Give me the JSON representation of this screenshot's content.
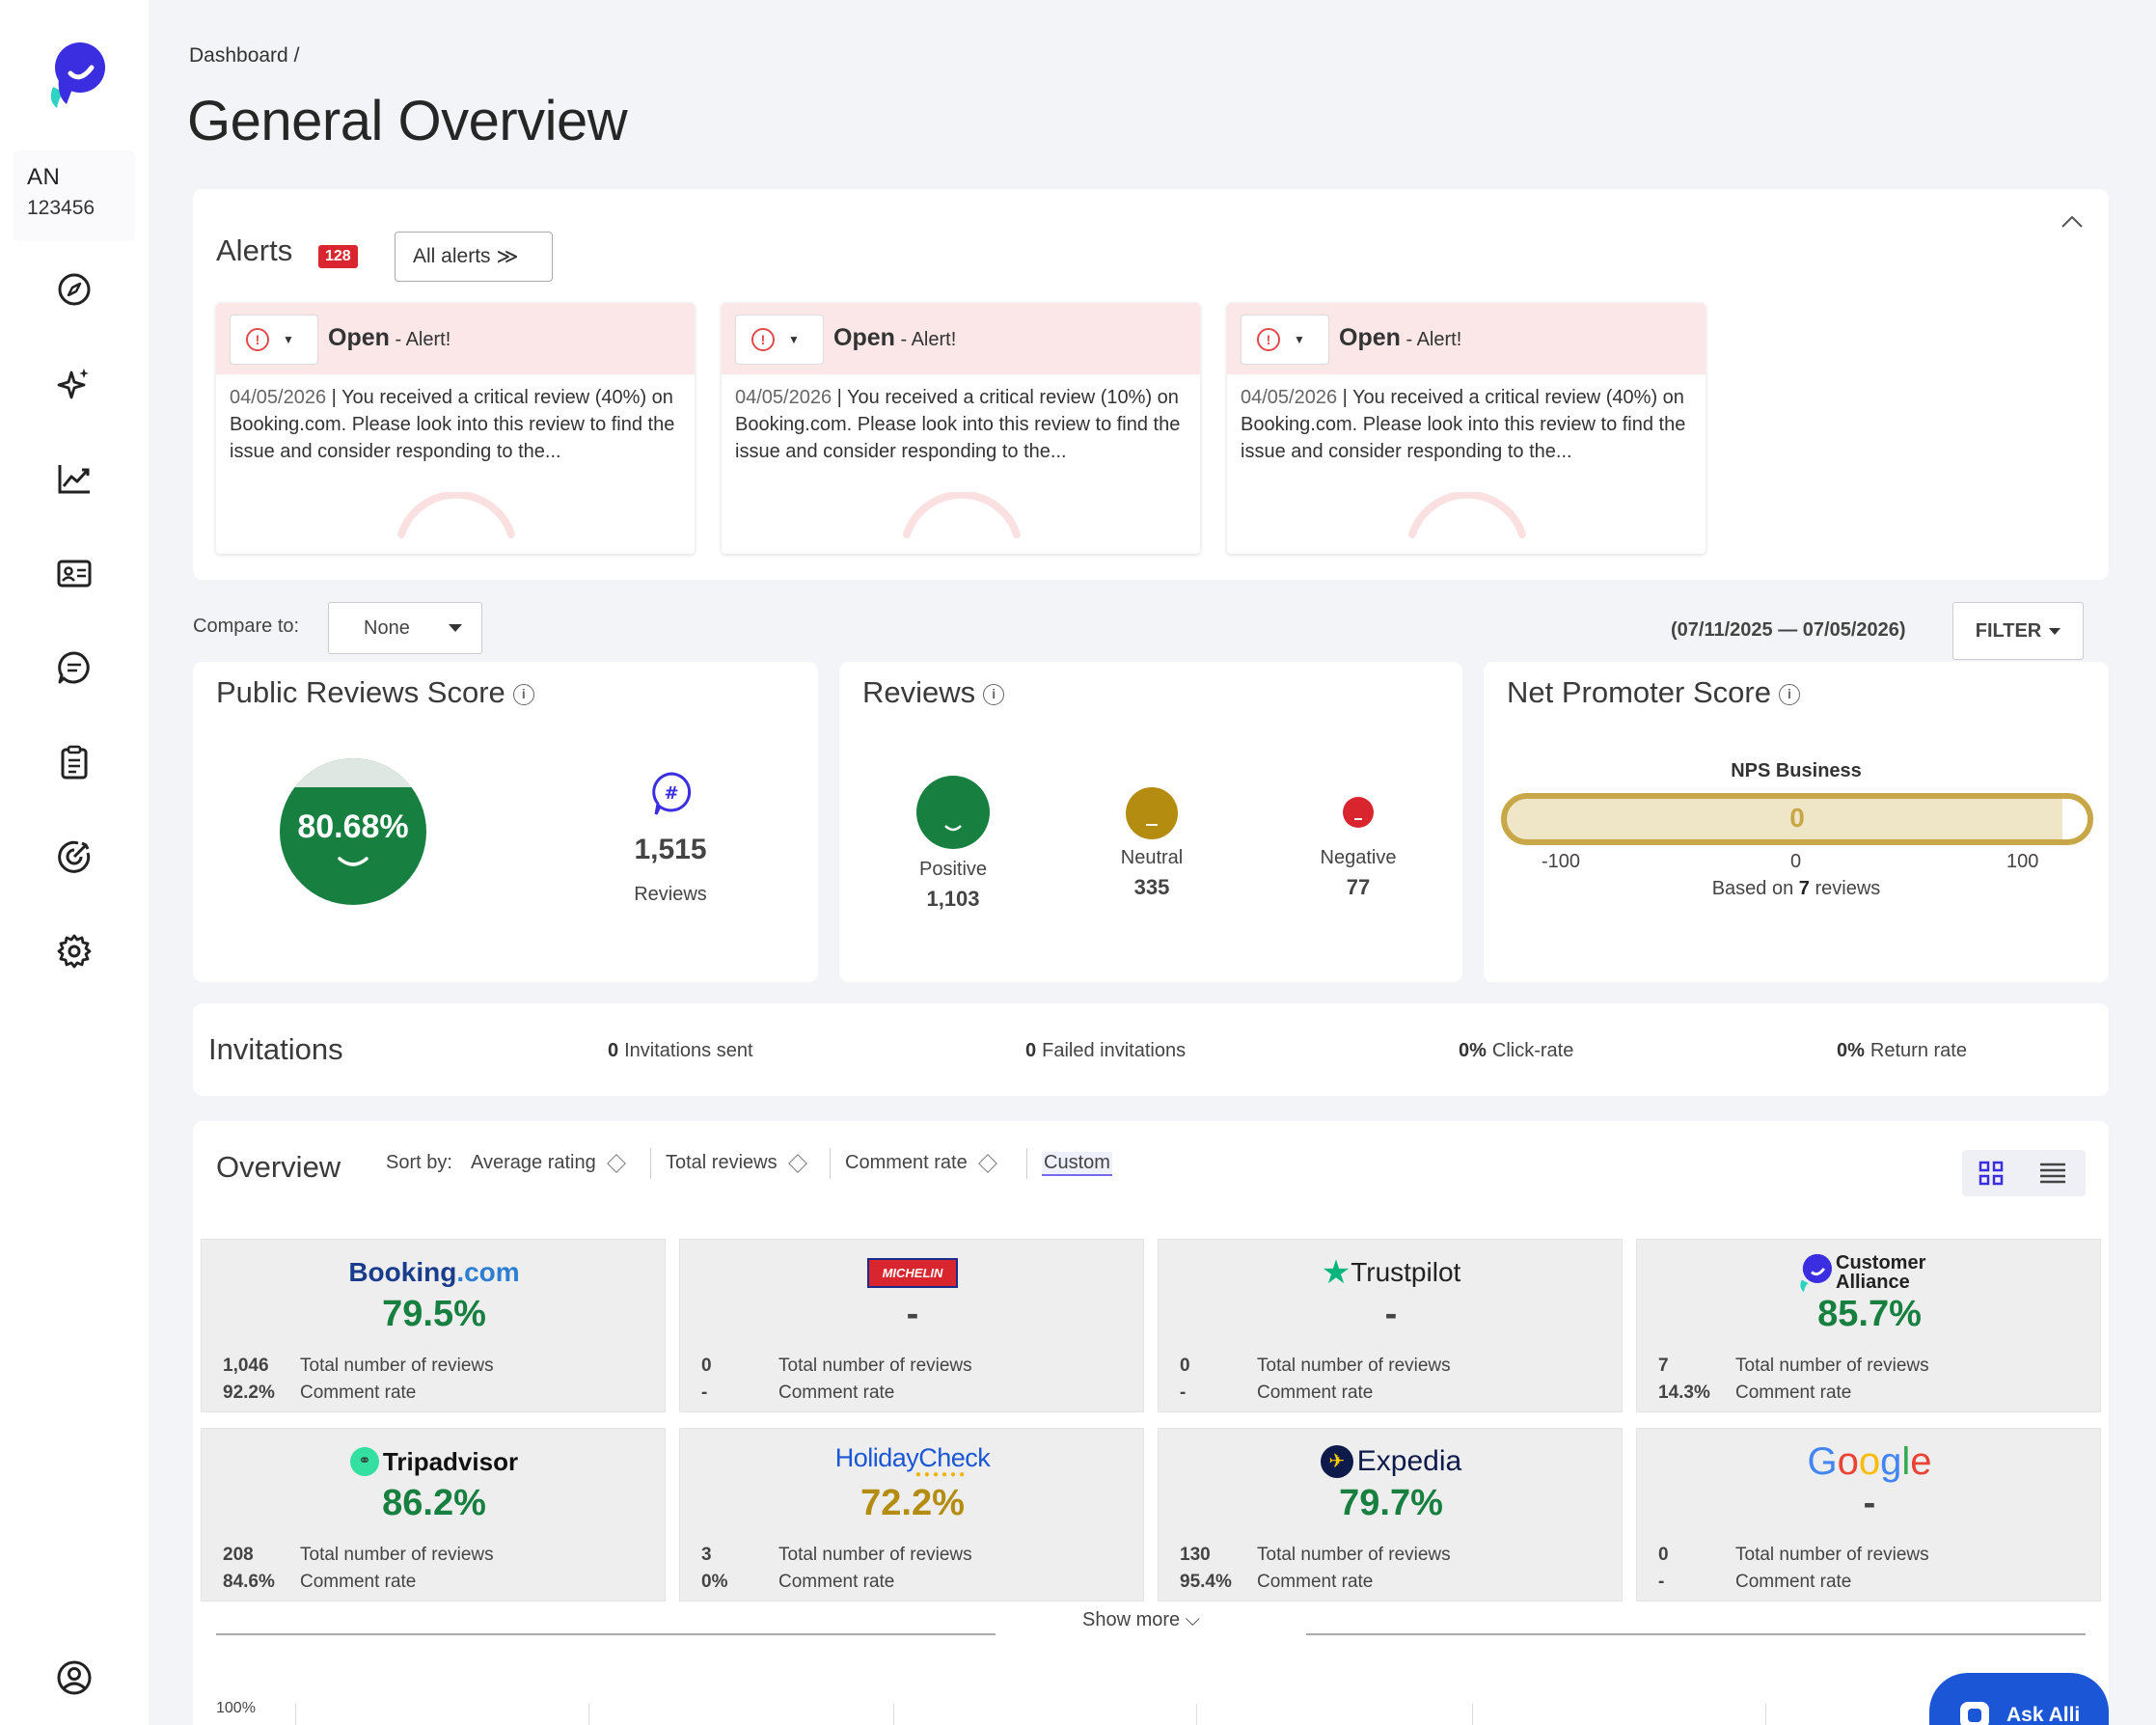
{
  "sidebar": {
    "account_code": "AN",
    "account_number": "123456",
    "icons": [
      "compass-icon",
      "sparkle-icon",
      "chart-line-icon",
      "id-card-icon",
      "chat-icon",
      "clipboard-icon",
      "target-icon",
      "gear-icon",
      "user-circle-icon"
    ]
  },
  "header": {
    "breadcrumb": "Dashboard  /",
    "title": "General Overview"
  },
  "alerts": {
    "title": "Alerts",
    "count": "128",
    "all_label": "All alerts",
    "items": [
      {
        "status": "Open",
        "suffix": " - Alert!",
        "date": "04/05/2026",
        "text": " | You received a critical review (40%) on Booking.com. Please look into this review to find the issue and consider responding to the..."
      },
      {
        "status": "Open",
        "suffix": " - Alert!",
        "date": "04/05/2026",
        "text": " | You received a critical review (10%) on Booking.com. Please look into this review to find the issue and consider responding to the..."
      },
      {
        "status": "Open",
        "suffix": " - Alert!",
        "date": "04/05/2026",
        "text": " | You received a critical review (40%) on Booking.com. Please look into this review to find the issue and consider responding to the..."
      }
    ]
  },
  "compare": {
    "label": "Compare to:",
    "value": "None"
  },
  "date_range": "(07/11/2025 — 07/05/2026)",
  "filter_label": "FILTER",
  "public_reviews": {
    "title": "Public Reviews Score",
    "score": "80.68%",
    "count": "1,515",
    "count_label": "Reviews"
  },
  "reviews": {
    "title": "Reviews",
    "positive": {
      "label": "Positive",
      "value": "1,103"
    },
    "neutral": {
      "label": "Neutral",
      "value": "335"
    },
    "negative": {
      "label": "Negative",
      "value": "77"
    }
  },
  "nps": {
    "title": "Net Promoter Score",
    "label": "NPS Business",
    "value": "0",
    "min": "-100",
    "mid": "0",
    "max": "100",
    "based_prefix": "Based on ",
    "based_count": "7",
    "based_suffix": " reviews"
  },
  "invitations": {
    "title": "Invitations",
    "sent": {
      "value": "0",
      "label": "Invitations sent"
    },
    "failed": {
      "value": "0",
      "label": "Failed invitations"
    },
    "click": {
      "value": "0%",
      "label": "Click-rate"
    },
    "ret": {
      "value": "0%",
      "label": "Return rate"
    }
  },
  "overview": {
    "title": "Overview",
    "sort_label": "Sort by:",
    "sort_options": [
      "Average rating",
      "Total reviews",
      "Comment rate"
    ],
    "custom_label": "Custom",
    "total_label": "Total number of reviews",
    "comment_label": "Comment rate",
    "show_more": "Show more",
    "axis_top": "100%",
    "platforms": [
      {
        "name": "Booking.com",
        "pct": "79.5%",
        "color": "#178040",
        "total": "1,046",
        "comment": "92.2%"
      },
      {
        "name": "MICHELIN",
        "pct": "-",
        "color": "#444444",
        "total": "0",
        "comment": "-"
      },
      {
        "name": "Trustpilot",
        "pct": "-",
        "color": "#444444",
        "total": "0",
        "comment": "-"
      },
      {
        "name": "Customer Alliance",
        "pct": "85.7%",
        "color": "#178040",
        "total": "7",
        "comment": "14.3%"
      },
      {
        "name": "Tripadvisor",
        "pct": "86.2%",
        "color": "#178040",
        "total": "208",
        "comment": "84.6%"
      },
      {
        "name": "HolidayCheck",
        "pct": "72.2%",
        "color": "#b38c10",
        "total": "3",
        "comment": "0%"
      },
      {
        "name": "Expedia",
        "pct": "79.7%",
        "color": "#178040",
        "total": "130",
        "comment": "95.4%"
      },
      {
        "name": "Google",
        "pct": "-",
        "color": "#444444",
        "total": "0",
        "comment": "-"
      }
    ]
  },
  "ask_label": "Ask Alli"
}
